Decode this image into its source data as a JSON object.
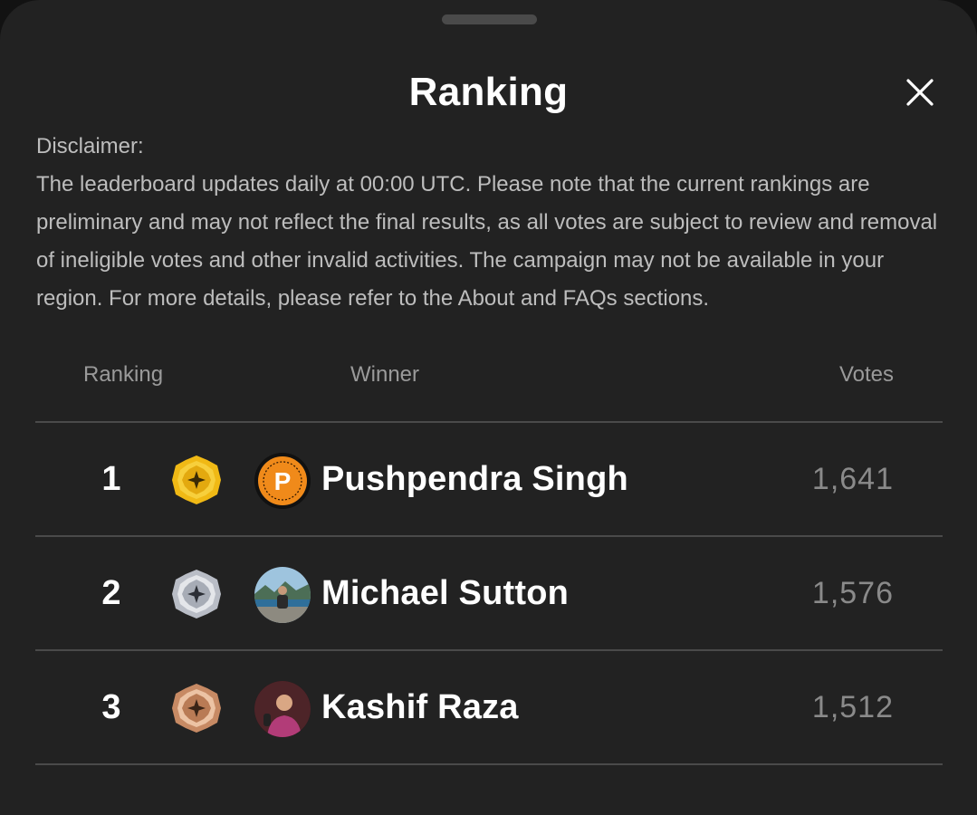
{
  "header": {
    "title": "Ranking"
  },
  "disclaimer": {
    "heading": "Disclaimer:",
    "body": "The leaderboard updates daily at 00:00 UTC. Please note that the current rankings are preliminary and may not reflect the final results, as all votes are subject to review and removal of ineligible votes and other invalid activities. The campaign may not be available in your region. For more details, please refer to the About and FAQs sections."
  },
  "table": {
    "columns": {
      "ranking": "Ranking",
      "winner": "Winner",
      "votes": "Votes"
    },
    "rows": [
      {
        "rank": "1",
        "medal": "gold-medal-icon",
        "name": "Pushpendra Singh",
        "votes": "1,641",
        "avatar_letter": "P"
      },
      {
        "rank": "2",
        "medal": "silver-medal-icon",
        "name": "Michael Sutton",
        "votes": "1,576"
      },
      {
        "rank": "3",
        "medal": "bronze-medal-icon",
        "name": "Kashif Raza",
        "votes": "1,512"
      }
    ]
  },
  "colors": {
    "background": "#222222",
    "gold": "#f2c020",
    "silver": "#c9ccd3",
    "bronze": "#d7a07c"
  }
}
